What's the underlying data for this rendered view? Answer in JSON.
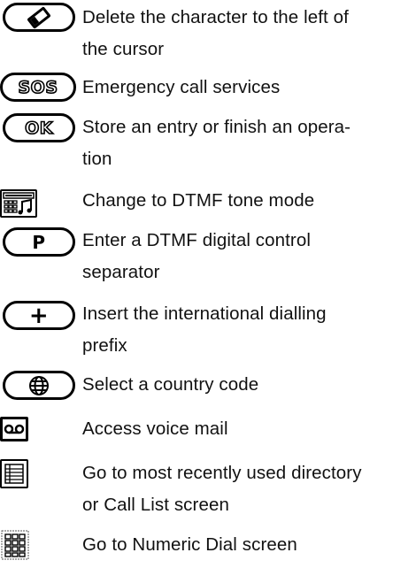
{
  "rows": [
    {
      "icon": "backspace-key-icon",
      "lines": [
        "Delete the character to the left of",
        "the cursor"
      ]
    },
    {
      "icon": "sos-key-icon",
      "key_label": "SOS",
      "lines": [
        "Emergency call services"
      ]
    },
    {
      "icon": "ok-key-icon",
      "key_label": "OK",
      "lines": [
        "Store an entry or finish an opera-",
        "tion"
      ]
    },
    {
      "icon": "dtmf-tone-icon",
      "lines": [
        "Change to DTMF tone mode"
      ]
    },
    {
      "icon": "p-key-icon",
      "key_label": "P",
      "lines": [
        "Enter a DTMF digital control",
        "separator"
      ]
    },
    {
      "icon": "plus-key-icon",
      "key_label": "+",
      "lines": [
        "Insert the international dialling",
        "prefix"
      ]
    },
    {
      "icon": "globe-key-icon",
      "lines": [
        "Select a country code"
      ]
    },
    {
      "icon": "voicemail-icon",
      "lines": [
        "Access voice mail"
      ]
    },
    {
      "icon": "directory-list-icon",
      "lines": [
        "Go to most recently used directory",
        "or Call List screen"
      ]
    },
    {
      "icon": "numeric-dial-icon",
      "lines": [
        "Go to Numeric Dial screen"
      ]
    }
  ]
}
